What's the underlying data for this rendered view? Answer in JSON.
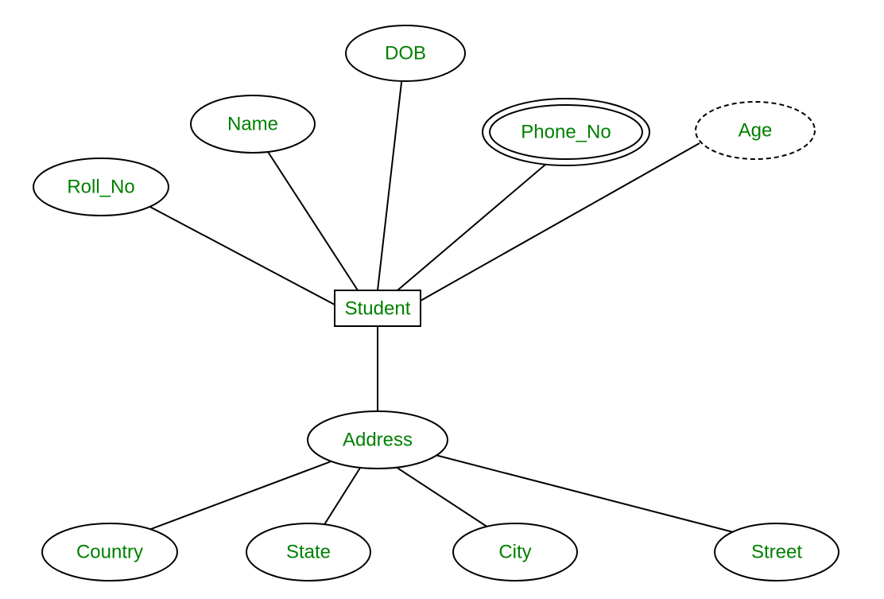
{
  "diagram": {
    "type": "ER-diagram",
    "entity": {
      "label": "Student"
    },
    "attributes": {
      "roll_no": {
        "label": "Roll_No",
        "kind": "simple"
      },
      "name": {
        "label": "Name",
        "kind": "simple"
      },
      "dob": {
        "label": "DOB",
        "kind": "simple"
      },
      "phone_no": {
        "label": "Phone_No",
        "kind": "multivalued"
      },
      "age": {
        "label": "Age",
        "kind": "derived"
      },
      "address": {
        "label": "Address",
        "kind": "composite"
      }
    },
    "address_components": {
      "country": {
        "label": "Country"
      },
      "state": {
        "label": "State"
      },
      "city": {
        "label": "City"
      },
      "street": {
        "label": "Street"
      }
    }
  }
}
